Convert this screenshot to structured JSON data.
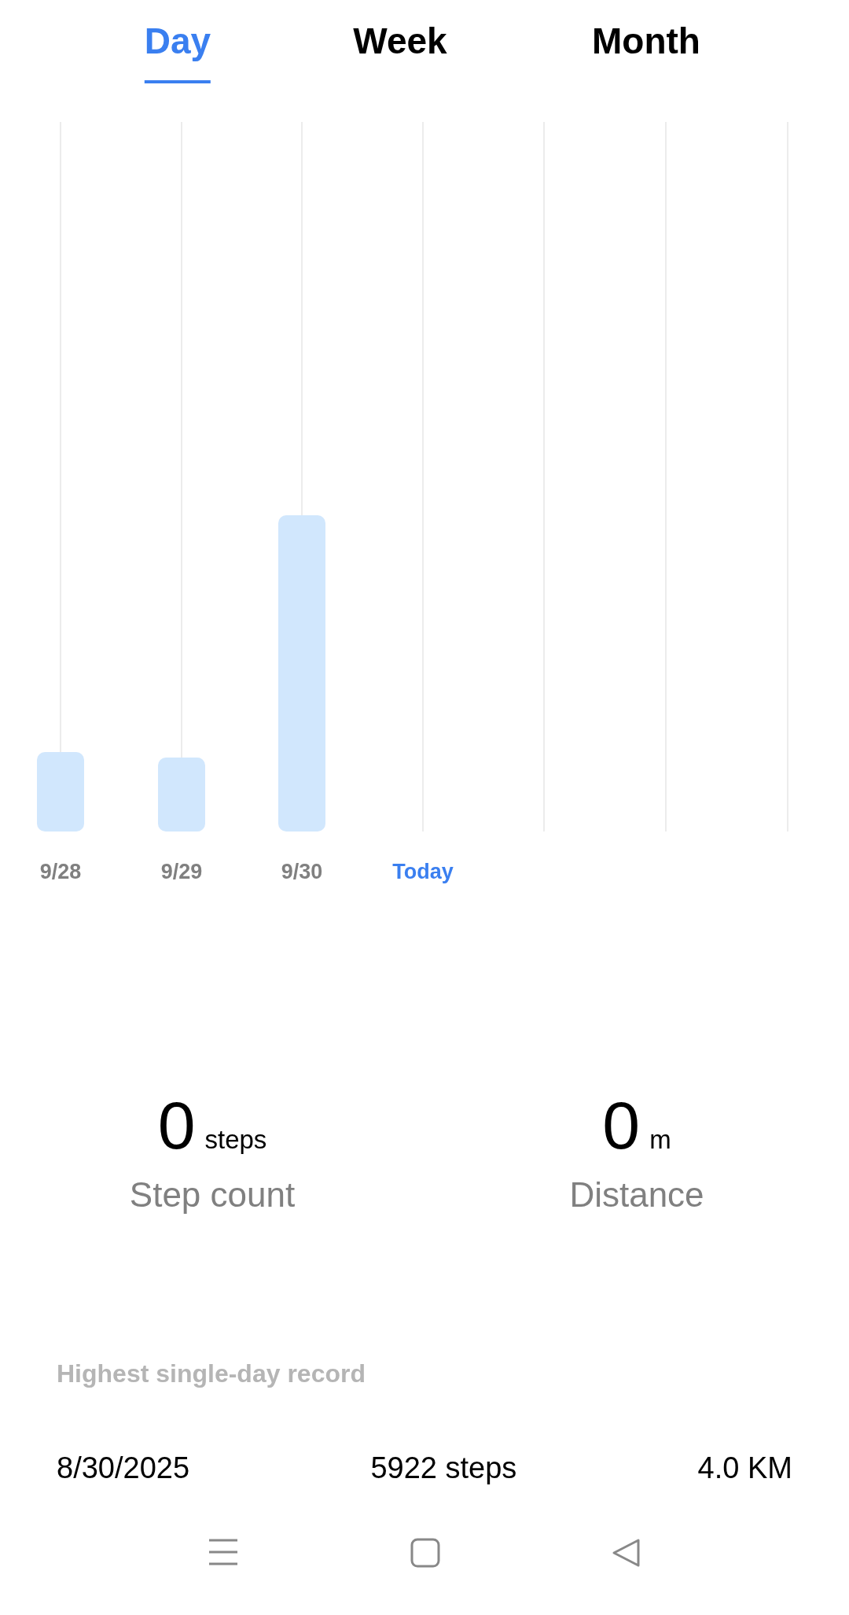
{
  "tabs": [
    {
      "label": "Day",
      "selected": true
    },
    {
      "label": "Week",
      "selected": false
    },
    {
      "label": "Month",
      "selected": false
    }
  ],
  "chart": {
    "labels": [
      {
        "text": "9/28",
        "current": false
      },
      {
        "text": "9/29",
        "current": false
      },
      {
        "text": "9/30",
        "current": false
      },
      {
        "text": "Today",
        "current": true
      }
    ]
  },
  "stats": [
    {
      "value": "0",
      "unit": "steps",
      "label": "Step count"
    },
    {
      "value": "0",
      "unit": "m",
      "label": "Distance"
    }
  ],
  "record": {
    "title": "Highest single-day record",
    "date": "8/30/2025",
    "steps": "5922 steps",
    "distance": "4.0 KM"
  }
}
